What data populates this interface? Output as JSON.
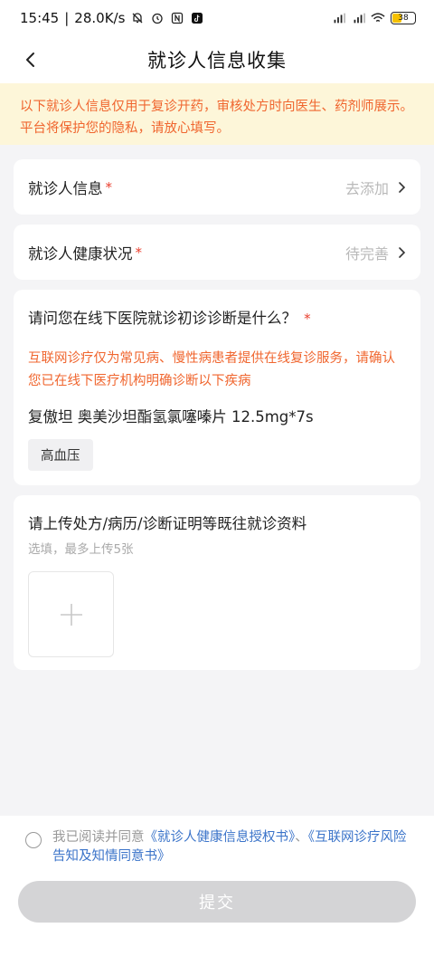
{
  "status_bar": {
    "time": "15:45",
    "net_speed": "28.0K/s",
    "battery": "38"
  },
  "nav": {
    "title": "就诊人信息收集"
  },
  "notice": {
    "text": "以下就诊人信息仅用于复诊开药，审核处方时向医生、药剂师展示。平台将保护您的隐私，请放心填写。"
  },
  "patient_info": {
    "label": "就诊人信息",
    "required_mark": "*",
    "value": "去添加"
  },
  "health_status": {
    "label": "就诊人健康状况",
    "required_mark": "*",
    "value": "待完善"
  },
  "diagnosis": {
    "question": "请问您在线下医院就诊初诊诊断是什么？",
    "required_mark": "*",
    "note": "互联网诊疗仅为常见病、慢性病患者提供在线复诊服务，请确认您已在线下医疗机构明确诊断以下疾病",
    "drug": "复傲坦 奥美沙坦酯氢氯噻嗪片 12.5mg*7s",
    "tag": "高血压"
  },
  "upload": {
    "title": "请上传处方/病历/诊断证明等既往就诊资料",
    "subtitle": "选填，最多上传5张"
  },
  "agreement": {
    "prefix": "我已阅读并同意",
    "link1": "《就诊人健康信息授权书》",
    "separator": "、",
    "link2": "《互联网诊疗风险告知及知情同意书》"
  },
  "submit_label": "提交"
}
